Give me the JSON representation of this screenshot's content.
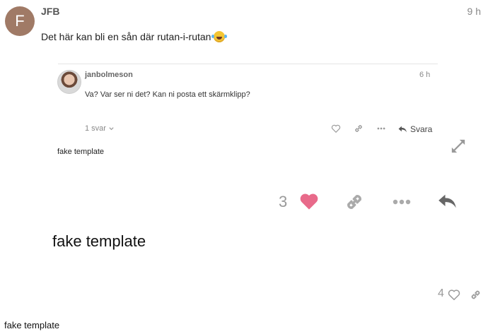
{
  "outer_post": {
    "avatar_letter": "F",
    "username": "JFB",
    "time": "9 h",
    "text": "Det här kan bli en sån där rutan-i-rutan"
  },
  "embedded": {
    "username": "janbolmeson",
    "time": "6 h",
    "text": "Va? Var ser ni det? Kan ni posta ett skärmklipp?",
    "replies": "1 svar",
    "reply_label": "Svara",
    "caption": "fake template"
  },
  "big_actions": {
    "like_count": "3"
  },
  "caption_large": "fake template",
  "bottom_actions": {
    "like_count": "4"
  },
  "caption_bottom": "fake template",
  "colors": {
    "heart": "#e86a8a",
    "avatar_f": "#a07a66"
  }
}
